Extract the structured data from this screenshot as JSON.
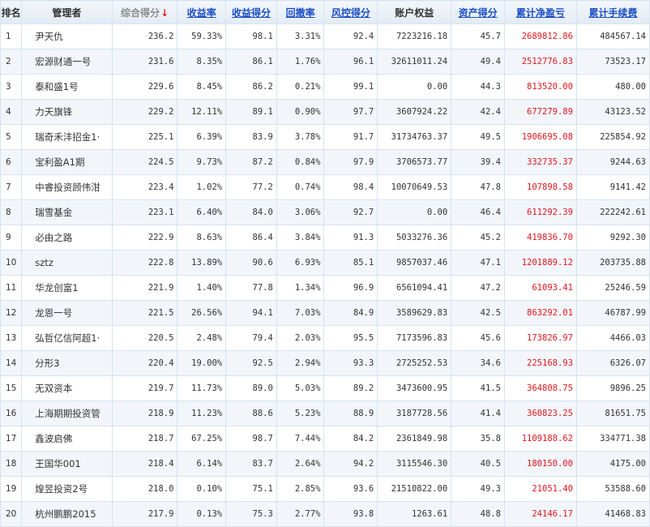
{
  "columns": [
    {
      "label": "排名",
      "style": "plain"
    },
    {
      "label": "管理者",
      "style": "plain"
    },
    {
      "label": "综合得分",
      "style": "gray",
      "sort_indicator": "↓",
      "sort_color": "#e02020"
    },
    {
      "label": "收益率",
      "style": "link"
    },
    {
      "label": "收益得分",
      "style": "link"
    },
    {
      "label": "回撤率",
      "style": "link"
    },
    {
      "label": "风控得分",
      "style": "link"
    },
    {
      "label": "账户权益",
      "style": "plain"
    },
    {
      "label": "资产得分",
      "style": "link"
    },
    {
      "label": "累计净盈亏",
      "style": "link"
    },
    {
      "label": "累计手续费",
      "style": "link"
    }
  ],
  "colors": {
    "header_link": "#1d4fc4",
    "profit_red": "#e0161e",
    "row_alt": "#f2f6fa",
    "grid_line": "#d7e3ef"
  },
  "rows": [
    {
      "rank": "1",
      "manager": "尹天仇",
      "total_score": "236.2",
      "return_rate": "59.33%",
      "return_score": "98.1",
      "drawdown": "3.31%",
      "risk_score": "92.4",
      "equity": "7223216.18",
      "asset_score": "45.7",
      "net_pnl": "2689812.86",
      "fees": "484567.14"
    },
    {
      "rank": "2",
      "manager": "宏源财通一号",
      "total_score": "231.6",
      "return_rate": "8.35%",
      "return_score": "86.1",
      "drawdown": "1.76%",
      "risk_score": "96.1",
      "equity": "32611011.24",
      "asset_score": "49.4",
      "net_pnl": "2512776.83",
      "fees": "73523.17"
    },
    {
      "rank": "3",
      "manager": "泰和盛1号",
      "total_score": "229.6",
      "return_rate": "8.45%",
      "return_score": "86.2",
      "drawdown": "0.21%",
      "risk_score": "99.1",
      "equity": "0.00",
      "asset_score": "44.3",
      "net_pnl": "813520.00",
      "fees": "480.00"
    },
    {
      "rank": "4",
      "manager": "力天旗锋",
      "total_score": "229.2",
      "return_rate": "12.11%",
      "return_score": "89.1",
      "drawdown": "0.90%",
      "risk_score": "97.7",
      "equity": "3607924.22",
      "asset_score": "42.4",
      "net_pnl": "677279.89",
      "fees": "43123.52"
    },
    {
      "rank": "5",
      "manager": "瑞奇禾沣招金1·",
      "total_score": "225.1",
      "return_rate": "6.39%",
      "return_score": "83.9",
      "drawdown": "3.78%",
      "risk_score": "91.7",
      "equity": "31734763.37",
      "asset_score": "49.5",
      "net_pnl": "1906695.08",
      "fees": "225854.92"
    },
    {
      "rank": "6",
      "manager": "宝利盈A1期",
      "total_score": "224.5",
      "return_rate": "9.73%",
      "return_score": "87.2",
      "drawdown": "0.84%",
      "risk_score": "97.9",
      "equity": "3706573.77",
      "asset_score": "39.4",
      "net_pnl": "332735.37",
      "fees": "9244.63"
    },
    {
      "rank": "7",
      "manager": "中睿投资顾伟泔",
      "total_score": "223.4",
      "return_rate": "1.02%",
      "return_score": "77.2",
      "drawdown": "0.74%",
      "risk_score": "98.4",
      "equity": "10070649.53",
      "asset_score": "47.8",
      "net_pnl": "107898.58",
      "fees": "9141.42"
    },
    {
      "rank": "8",
      "manager": "瑞雪基金",
      "total_score": "223.1",
      "return_rate": "6.40%",
      "return_score": "84.0",
      "drawdown": "3.06%",
      "risk_score": "92.7",
      "equity": "0.00",
      "asset_score": "46.4",
      "net_pnl": "611292.39",
      "fees": "222242.61"
    },
    {
      "rank": "9",
      "manager": "必由之路",
      "total_score": "222.9",
      "return_rate": "8.63%",
      "return_score": "86.4",
      "drawdown": "3.84%",
      "risk_score": "91.3",
      "equity": "5033276.36",
      "asset_score": "45.2",
      "net_pnl": "419836.70",
      "fees": "9292.30"
    },
    {
      "rank": "10",
      "manager": "sztz",
      "total_score": "222.8",
      "return_rate": "13.89%",
      "return_score": "90.6",
      "drawdown": "6.93%",
      "risk_score": "85.1",
      "equity": "9857037.46",
      "asset_score": "47.1",
      "net_pnl": "1201889.12",
      "fees": "203735.88"
    },
    {
      "rank": "11",
      "manager": "华龙创富1",
      "total_score": "221.9",
      "return_rate": "1.40%",
      "return_score": "77.8",
      "drawdown": "1.34%",
      "risk_score": "96.9",
      "equity": "6561094.41",
      "asset_score": "47.2",
      "net_pnl": "61093.41",
      "fees": "25246.59"
    },
    {
      "rank": "12",
      "manager": "龙恩一号",
      "total_score": "221.5",
      "return_rate": "26.56%",
      "return_score": "94.1",
      "drawdown": "7.03%",
      "risk_score": "84.9",
      "equity": "3589629.83",
      "asset_score": "42.5",
      "net_pnl": "863292.01",
      "fees": "46787.99"
    },
    {
      "rank": "13",
      "manager": "弘哲亿信阿超1·",
      "total_score": "220.5",
      "return_rate": "2.48%",
      "return_score": "79.4",
      "drawdown": "2.03%",
      "risk_score": "95.5",
      "equity": "7173596.83",
      "asset_score": "45.6",
      "net_pnl": "173826.97",
      "fees": "4466.03"
    },
    {
      "rank": "14",
      "manager": "分形3",
      "total_score": "220.4",
      "return_rate": "19.00%",
      "return_score": "92.5",
      "drawdown": "2.94%",
      "risk_score": "93.3",
      "equity": "2725252.53",
      "asset_score": "34.6",
      "net_pnl": "225168.93",
      "fees": "6326.07"
    },
    {
      "rank": "15",
      "manager": "无双资本",
      "total_score": "219.7",
      "return_rate": "11.73%",
      "return_score": "89.0",
      "drawdown": "5.03%",
      "risk_score": "89.2",
      "equity": "3473600.95",
      "asset_score": "41.5",
      "net_pnl": "364808.75",
      "fees": "9896.25"
    },
    {
      "rank": "16",
      "manager": "上海期期投资管",
      "total_score": "218.9",
      "return_rate": "11.23%",
      "return_score": "88.6",
      "drawdown": "5.23%",
      "risk_score": "88.9",
      "equity": "3187728.56",
      "asset_score": "41.4",
      "net_pnl": "360823.25",
      "fees": "81651.75"
    },
    {
      "rank": "17",
      "manager": "鑫波启佛",
      "total_score": "218.7",
      "return_rate": "67.25%",
      "return_score": "98.7",
      "drawdown": "7.44%",
      "risk_score": "84.2",
      "equity": "2361849.98",
      "asset_score": "35.8",
      "net_pnl": "1109188.62",
      "fees": "334771.38"
    },
    {
      "rank": "18",
      "manager": "王国华001",
      "total_score": "218.4",
      "return_rate": "6.14%",
      "return_score": "83.7",
      "drawdown": "2.64%",
      "risk_score": "94.2",
      "equity": "3115546.30",
      "asset_score": "40.5",
      "net_pnl": "180150.00",
      "fees": "4175.00"
    },
    {
      "rank": "19",
      "manager": "煌昱投资2号",
      "total_score": "218.0",
      "return_rate": "0.10%",
      "return_score": "75.1",
      "drawdown": "2.85%",
      "risk_score": "93.6",
      "equity": "21510822.00",
      "asset_score": "49.3",
      "net_pnl": "21051.40",
      "fees": "53588.60"
    },
    {
      "rank": "20",
      "manager": "杭州鹏鹏2015",
      "total_score": "217.9",
      "return_rate": "0.13%",
      "return_score": "75.3",
      "drawdown": "2.77%",
      "risk_score": "93.8",
      "equity": "1263.61",
      "asset_score": "48.8",
      "net_pnl": "24146.17",
      "fees": "41468.83"
    }
  ]
}
